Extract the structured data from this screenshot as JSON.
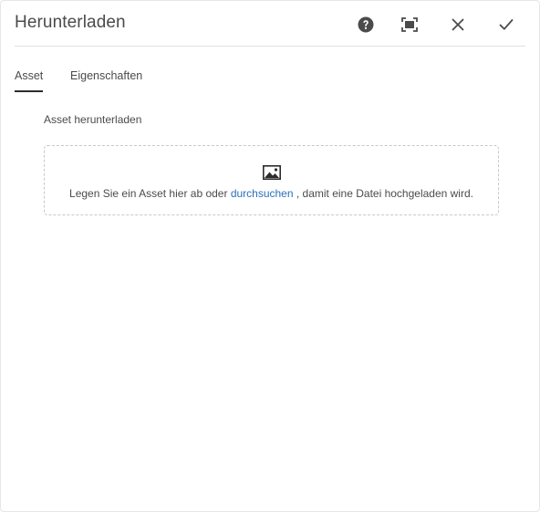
{
  "dialog": {
    "title": "Herunterladen",
    "actions": {
      "help_icon": "help-icon",
      "fullscreen_icon": "fullscreen-icon",
      "close_icon": "close-icon",
      "confirm_icon": "checkmark-icon"
    }
  },
  "tabs": [
    {
      "label": "Asset",
      "active": true
    },
    {
      "label": "Eigenschaften",
      "active": false
    }
  ],
  "asset_section": {
    "label": "Asset herunterladen",
    "dropzone": {
      "icon": "image-icon",
      "text_before": "Legen Sie ein Asset hier ab oder ",
      "link_text": "durchsuchen",
      "text_after": " , damit eine Datei hochgeladen wird."
    }
  },
  "colors": {
    "text": "#4b4b4b",
    "link": "#2d6fb9",
    "tab_indicator": "#2c2c2c",
    "divider": "#e1e1e1",
    "dropzone_border": "#c8c8c8"
  }
}
